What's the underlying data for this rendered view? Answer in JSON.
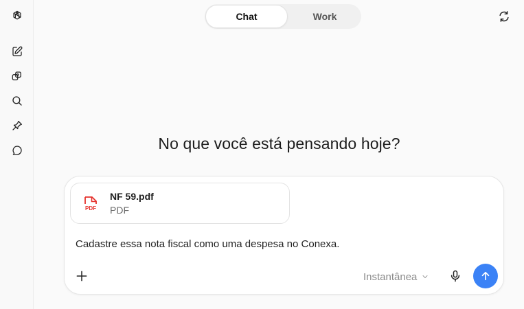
{
  "sidebar": {
    "items": [
      {
        "name": "logo",
        "icon": "openai-logo-icon"
      },
      {
        "name": "new-chat",
        "icon": "compose-icon"
      },
      {
        "name": "library",
        "icon": "library-icon"
      },
      {
        "name": "search",
        "icon": "search-icon"
      },
      {
        "name": "pins",
        "icon": "pin-icon"
      },
      {
        "name": "chats",
        "icon": "chat-bubble-icon"
      }
    ]
  },
  "header": {
    "tabs": [
      {
        "label": "Chat",
        "active": true
      },
      {
        "label": "Work",
        "active": false
      }
    ],
    "right_icon": "refresh-loop-icon"
  },
  "main": {
    "headline": "No que você está pensando hoje?"
  },
  "composer": {
    "attachment": {
      "file_name": "NF 59.pdf",
      "file_type": "PDF",
      "icon_label": "PDF",
      "icon_color": "#e5312c"
    },
    "text": "Cadastre essa nota fiscal como uma despesa no Conexa.",
    "model_label": "Instantânea",
    "send_color": "#3b82f6"
  }
}
